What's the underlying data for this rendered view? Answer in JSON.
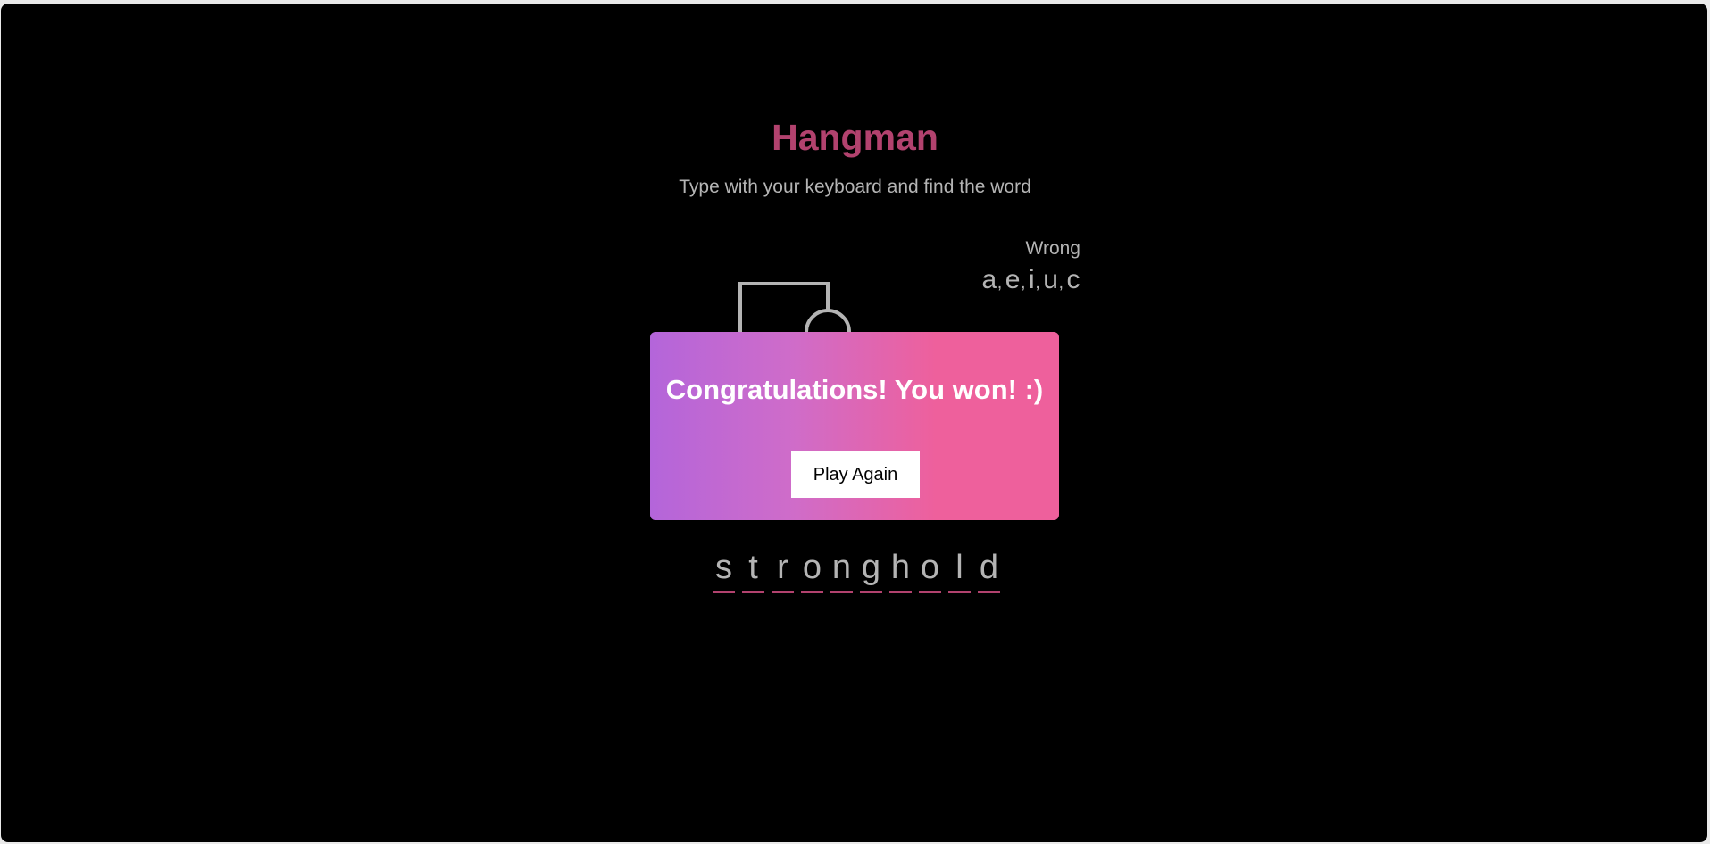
{
  "header": {
    "title": "Hangman",
    "subtitle": "Type with your keyboard and find the word"
  },
  "wrong": {
    "label": "Wrong",
    "letters": [
      "a",
      "e",
      "i",
      "u",
      "c"
    ],
    "separator": ","
  },
  "word": {
    "letters": [
      "s",
      "t",
      "r",
      "o",
      "n",
      "g",
      "h",
      "o",
      "l",
      "d"
    ]
  },
  "popup": {
    "message": "Congratulations! You won! :)",
    "button_label": "Play Again"
  },
  "colors": {
    "background": "#000000",
    "title": "#b2426e",
    "text": "#b4b4b4",
    "underline": "#b2426e",
    "popup_gradient_start": "#b465da",
    "popup_gradient_end": "#ee609c",
    "button_background": "#ffffff"
  }
}
